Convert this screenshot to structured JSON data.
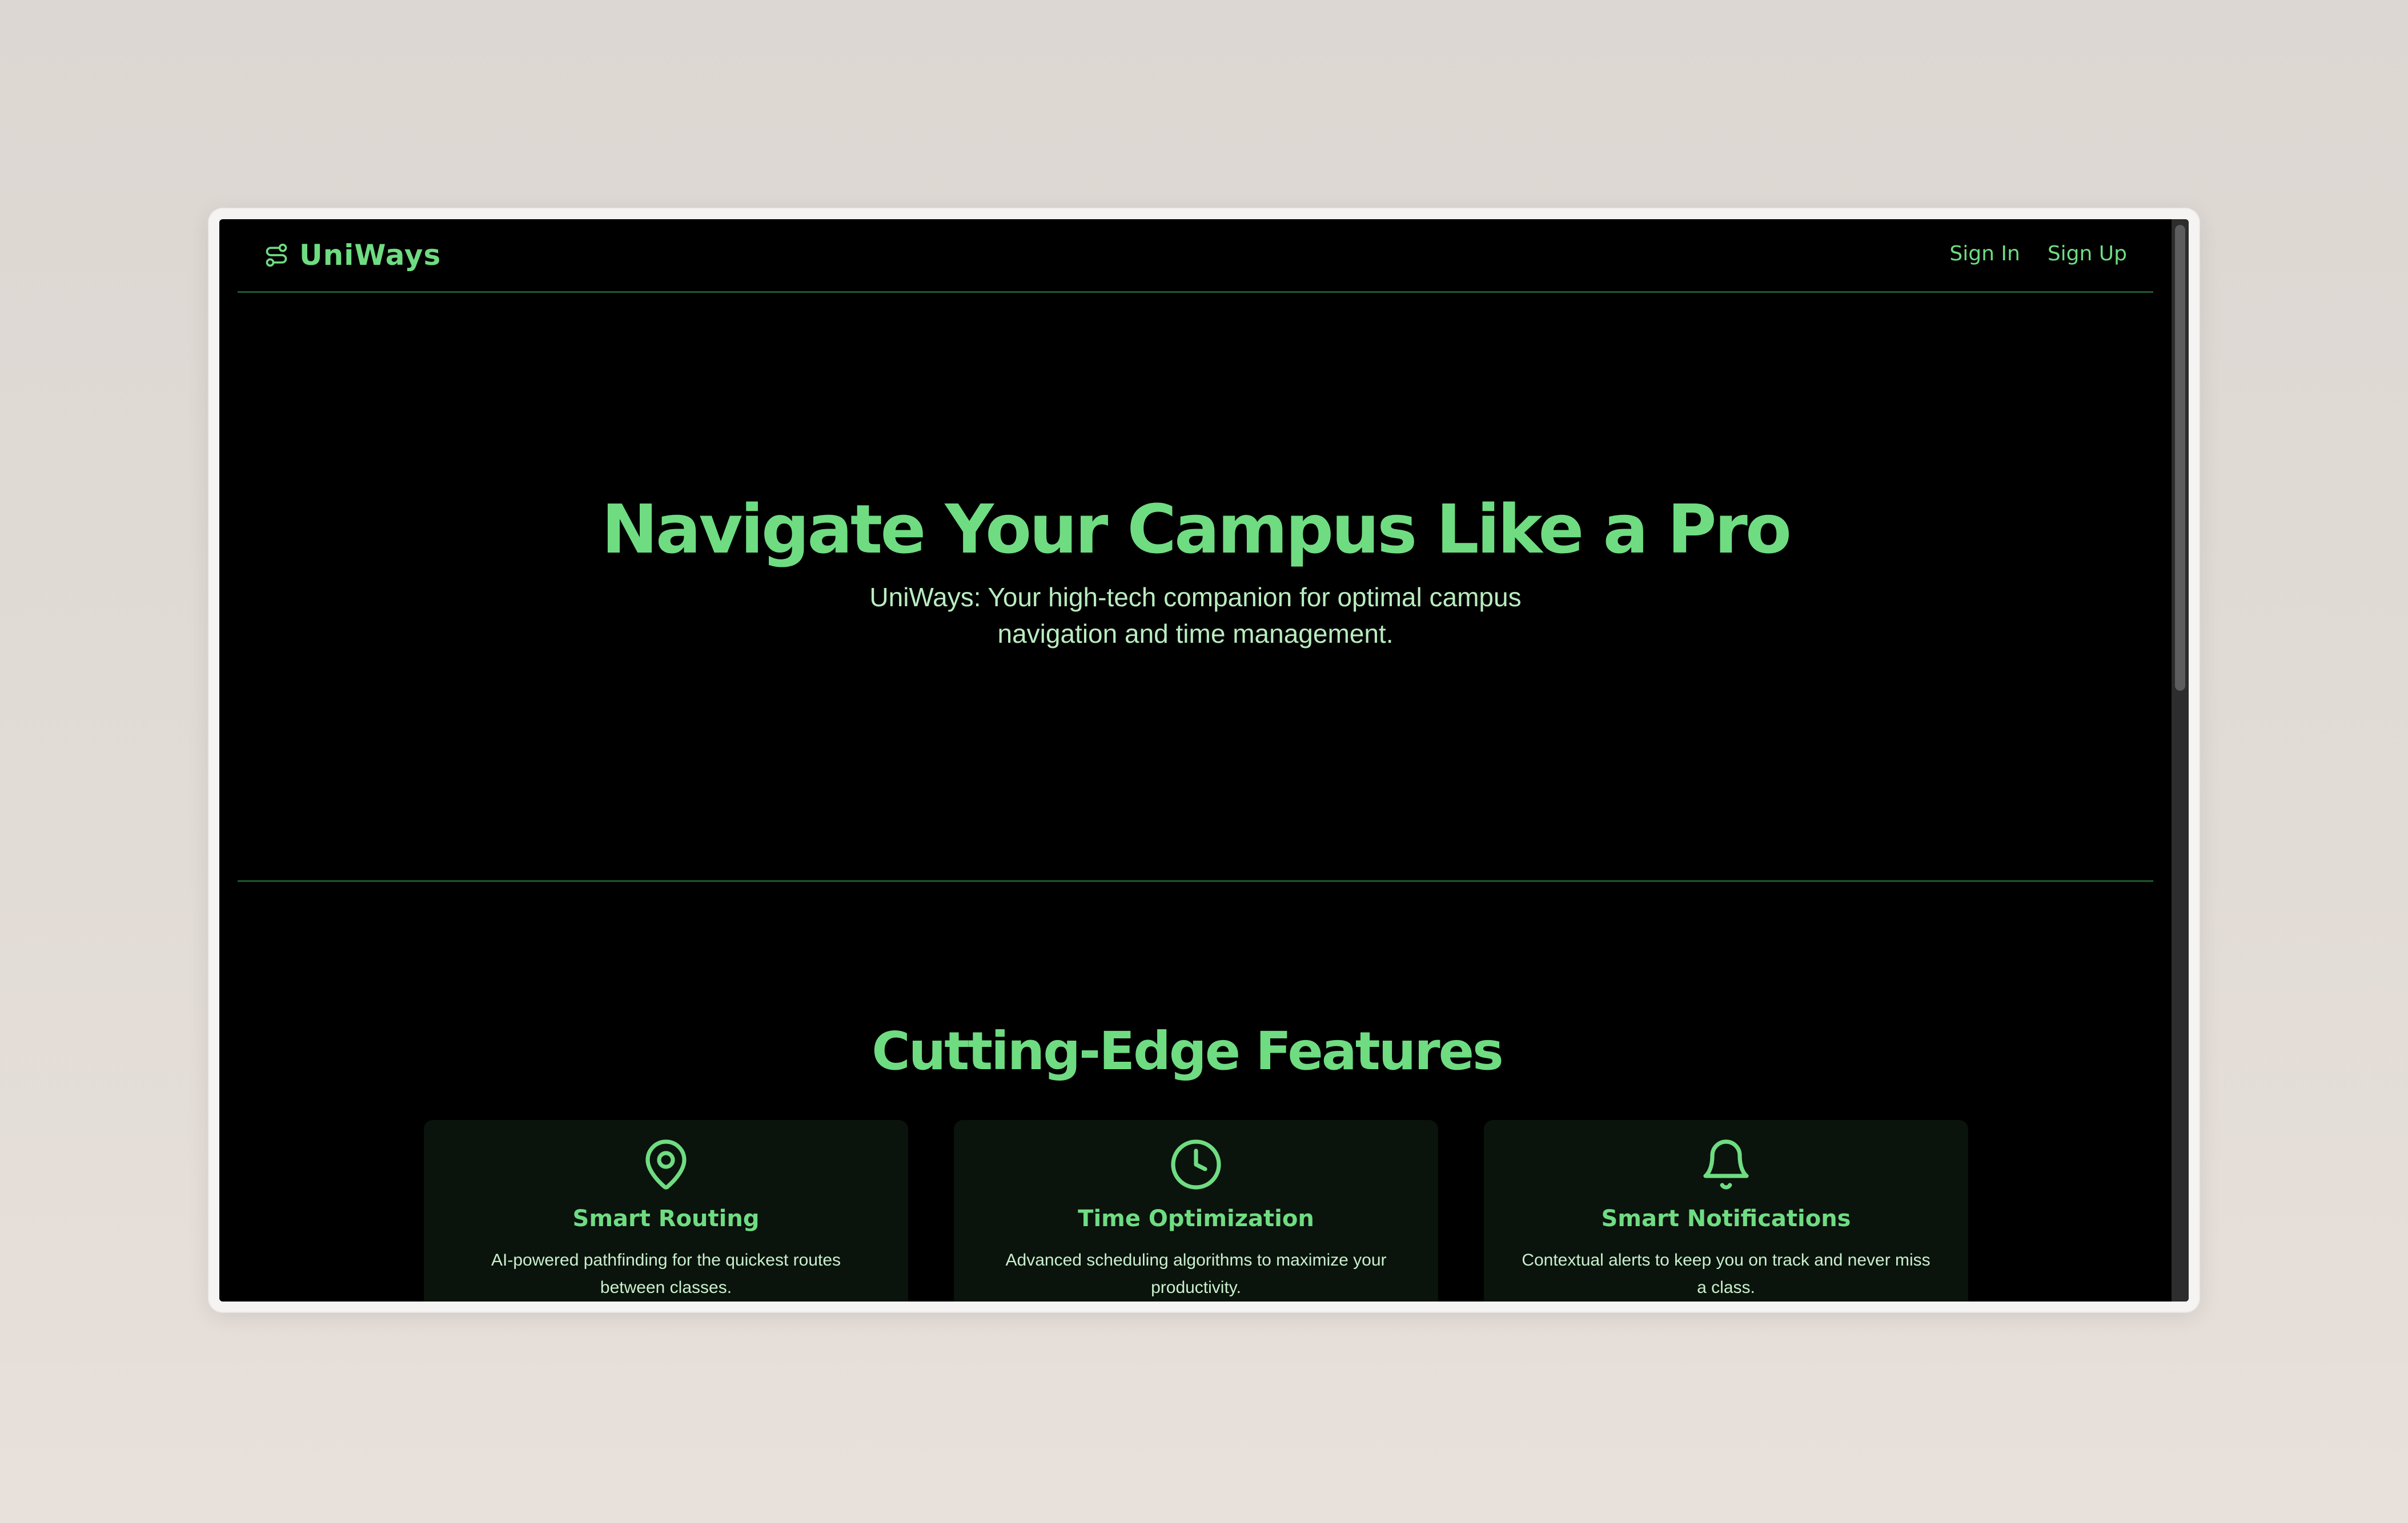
{
  "header": {
    "brand": "UniWays",
    "brand_icon": "route-icon",
    "nav": [
      {
        "label": "Sign In"
      },
      {
        "label": "Sign Up"
      }
    ]
  },
  "hero": {
    "title": "Navigate Your Campus Like a Pro",
    "subtitle": "UniWays: Your high-tech companion for optimal campus navigation and time management."
  },
  "features": {
    "title": "Cutting-Edge Features",
    "items": [
      {
        "icon": "map-pin-icon",
        "title": "Smart Routing",
        "description": "AI-powered pathfinding for the quickest routes between classes."
      },
      {
        "icon": "clock-icon",
        "title": "Time Optimization",
        "description": "Advanced scheduling algorithms to maximize your productivity."
      },
      {
        "icon": "bell-icon",
        "title": "Smart Notifications",
        "description": "Contextual alerts to keep you on track and never miss a class."
      }
    ]
  },
  "colors": {
    "accent": "#6fdc82",
    "background": "#000000",
    "card": "#0a130c",
    "divider": "#1d5a2f"
  }
}
